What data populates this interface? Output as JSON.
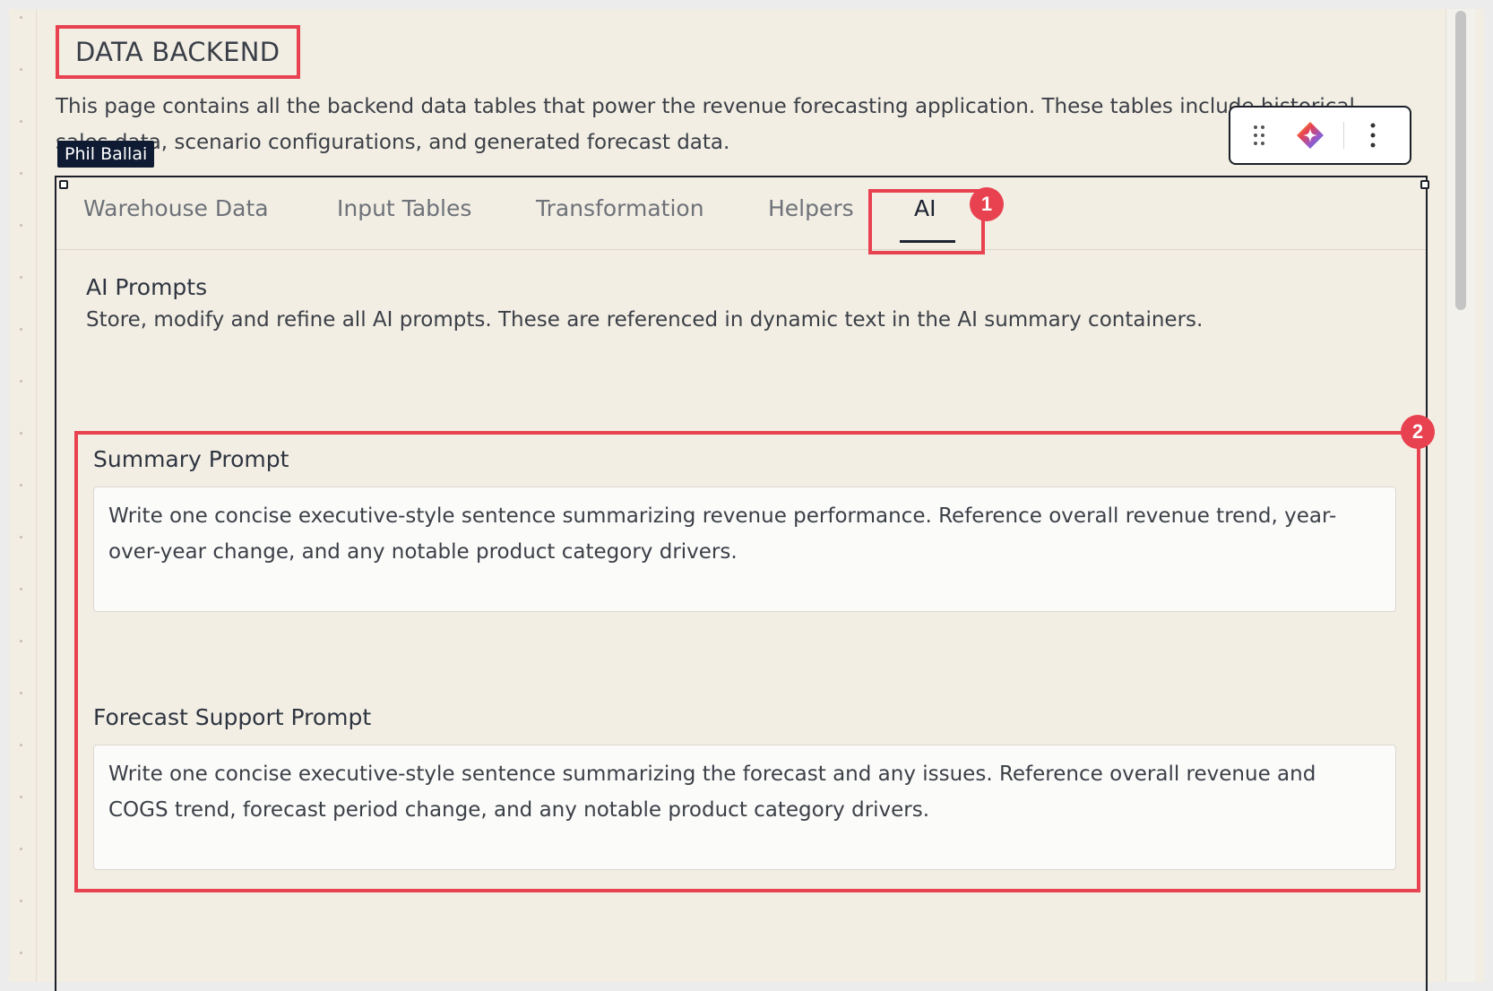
{
  "page": {
    "title": "DATA BACKEND",
    "description": "This page contains all the backend data tables that power the revenue forecasting application. These tables include historical sales data, scenario configurations, and generated forecast data."
  },
  "user_tag": "Phil Ballai",
  "toolbar": {
    "icons": [
      "drag-handle-icon",
      "ai-sparkle-icon",
      "more-vertical-icon"
    ]
  },
  "tabs": [
    {
      "label": "Warehouse Data",
      "active": false
    },
    {
      "label": "Input Tables",
      "active": false
    },
    {
      "label": "Transformation",
      "active": false
    },
    {
      "label": "Helpers",
      "active": false
    },
    {
      "label": "AI",
      "active": true
    }
  ],
  "ai_section": {
    "title": "AI Prompts",
    "description": "Store, modify and refine all AI prompts. These are referenced in dynamic text in the AI summary containers."
  },
  "prompts": [
    {
      "label": "Summary Prompt",
      "value": "Write one concise executive-style sentence summarizing revenue performance. Reference overall revenue trend, year-over-year change, and any notable product category drivers."
    },
    {
      "label": "Forecast Support Prompt",
      "value": "Write one concise executive-style sentence summarizing the forecast and any issues. Reference overall revenue and COGS trend, forecast period change, and any notable product category drivers."
    }
  ],
  "annotations": {
    "badge_1": "1",
    "badge_2": "2"
  },
  "colors": {
    "highlight": "#e8414f",
    "background": "#f2eee4",
    "user_tag_bg": "#0f1b33"
  }
}
